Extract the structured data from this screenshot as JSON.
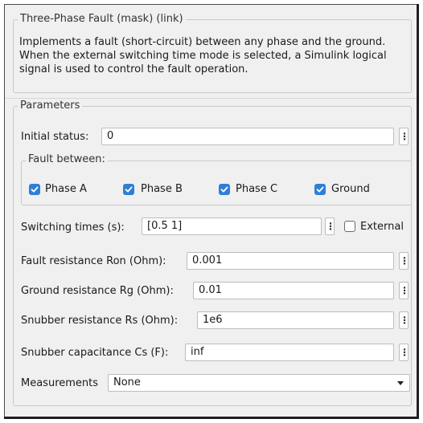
{
  "title": "Three-Phase Fault (mask) (link)",
  "description": "Implements a fault (short-circuit) between any phase and the ground. When the external switching time mode is selected, a Simulink logical signal is used to control the fault operation.",
  "parameters": {
    "title": "Parameters",
    "initial_status": {
      "label": "Initial status:",
      "value": "0"
    },
    "fault_between": {
      "title": "Fault between:",
      "options": [
        {
          "label": "Phase A",
          "checked": true
        },
        {
          "label": "Phase B",
          "checked": true
        },
        {
          "label": "Phase C",
          "checked": true
        },
        {
          "label": "Ground",
          "checked": true
        }
      ]
    },
    "switching_times": {
      "label": "Switching times (s):",
      "value": "[0.5  1]"
    },
    "external": {
      "label": "External",
      "checked": false
    },
    "fault_resistance": {
      "label": "Fault resistance Ron (Ohm):",
      "value": "0.001"
    },
    "ground_resistance": {
      "label": "Ground resistance Rg (Ohm):",
      "value": "0.01"
    },
    "snubber_resistance": {
      "label": "Snubber resistance Rs (Ohm):",
      "value": "1e6"
    },
    "snubber_capacitance": {
      "label": "Snubber capacitance Cs (F):",
      "value": "inf"
    },
    "measurements": {
      "label": "Measurements",
      "value": "None"
    }
  },
  "icons": {
    "more": "vertical-ellipsis-icon",
    "check": "checkmark-icon",
    "dropdown": "chevron-down-icon"
  },
  "colors": {
    "accent": "#2f7fd6",
    "panel": "#f0f0f0",
    "border": "#bdbdbd"
  },
  "glyphs": {
    "ellipsis": "⋮"
  }
}
